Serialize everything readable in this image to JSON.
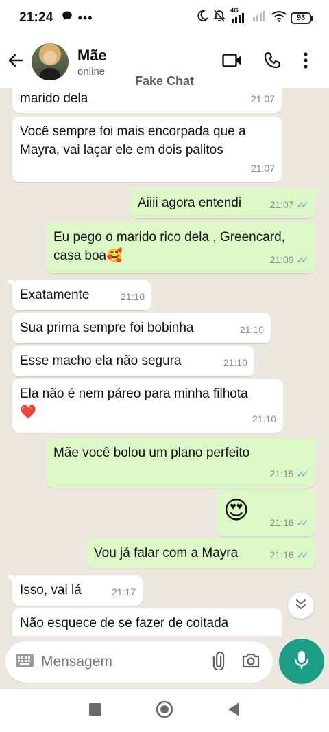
{
  "status_bar": {
    "time": "21:24",
    "battery": "93",
    "network_label": "4G"
  },
  "header": {
    "contact_name": "Mãe",
    "contact_status": "online",
    "watermark": "Fake Chat"
  },
  "messages": [
    {
      "dir": "in",
      "text": "marido dela",
      "time": "21:07"
    },
    {
      "dir": "in",
      "text": "Você sempre foi mais encorpada que a Mayra, vai laçar ele em dois palitos",
      "time": "21:07"
    },
    {
      "dir": "out",
      "text": "Aiiii agora entendi",
      "time": "21:07"
    },
    {
      "dir": "out",
      "text": "Eu pego o marido rico dela , Greencard, casa boa🥰",
      "time": "21:09"
    },
    {
      "dir": "in",
      "text": "Exatamente",
      "time": "21:10"
    },
    {
      "dir": "in",
      "text": "Sua prima sempre foi bobinha",
      "time": "21:10"
    },
    {
      "dir": "in",
      "text": "Esse macho ela não segura",
      "time": "21:10"
    },
    {
      "dir": "in",
      "text": "Ela não é nem páreo para minha filhota ❤️",
      "time": "21:10"
    },
    {
      "dir": "out",
      "text": "Mãe você bolou um plano perfeito",
      "time": "21:15"
    },
    {
      "dir": "out",
      "text": "😍",
      "time": "21:16"
    },
    {
      "dir": "out",
      "text": "Vou já falar com a Mayra",
      "time": "21:16"
    },
    {
      "dir": "in",
      "text": "Isso, vai lá",
      "time": "21:17"
    },
    {
      "dir": "in",
      "text": "Não esquece de se fazer de coitada",
      "time": ""
    }
  ],
  "composer": {
    "placeholder": "Mensagem"
  },
  "colors": {
    "outgoing_bubble": "#dcf8c6",
    "incoming_bubble": "#ffffff",
    "chat_background": "#ece8e0",
    "mic_button": "#1b9e85",
    "read_ticks": "#4fb6ec"
  },
  "icons": {
    "back": "arrow-left-icon",
    "video": "video-call-icon",
    "call": "phone-icon",
    "menu": "more-vert-icon",
    "keyboard": "keyboard-icon",
    "attach": "paperclip-icon",
    "camera": "camera-icon",
    "mic": "mic-icon",
    "scroll": "chevron-double-down-icon"
  }
}
